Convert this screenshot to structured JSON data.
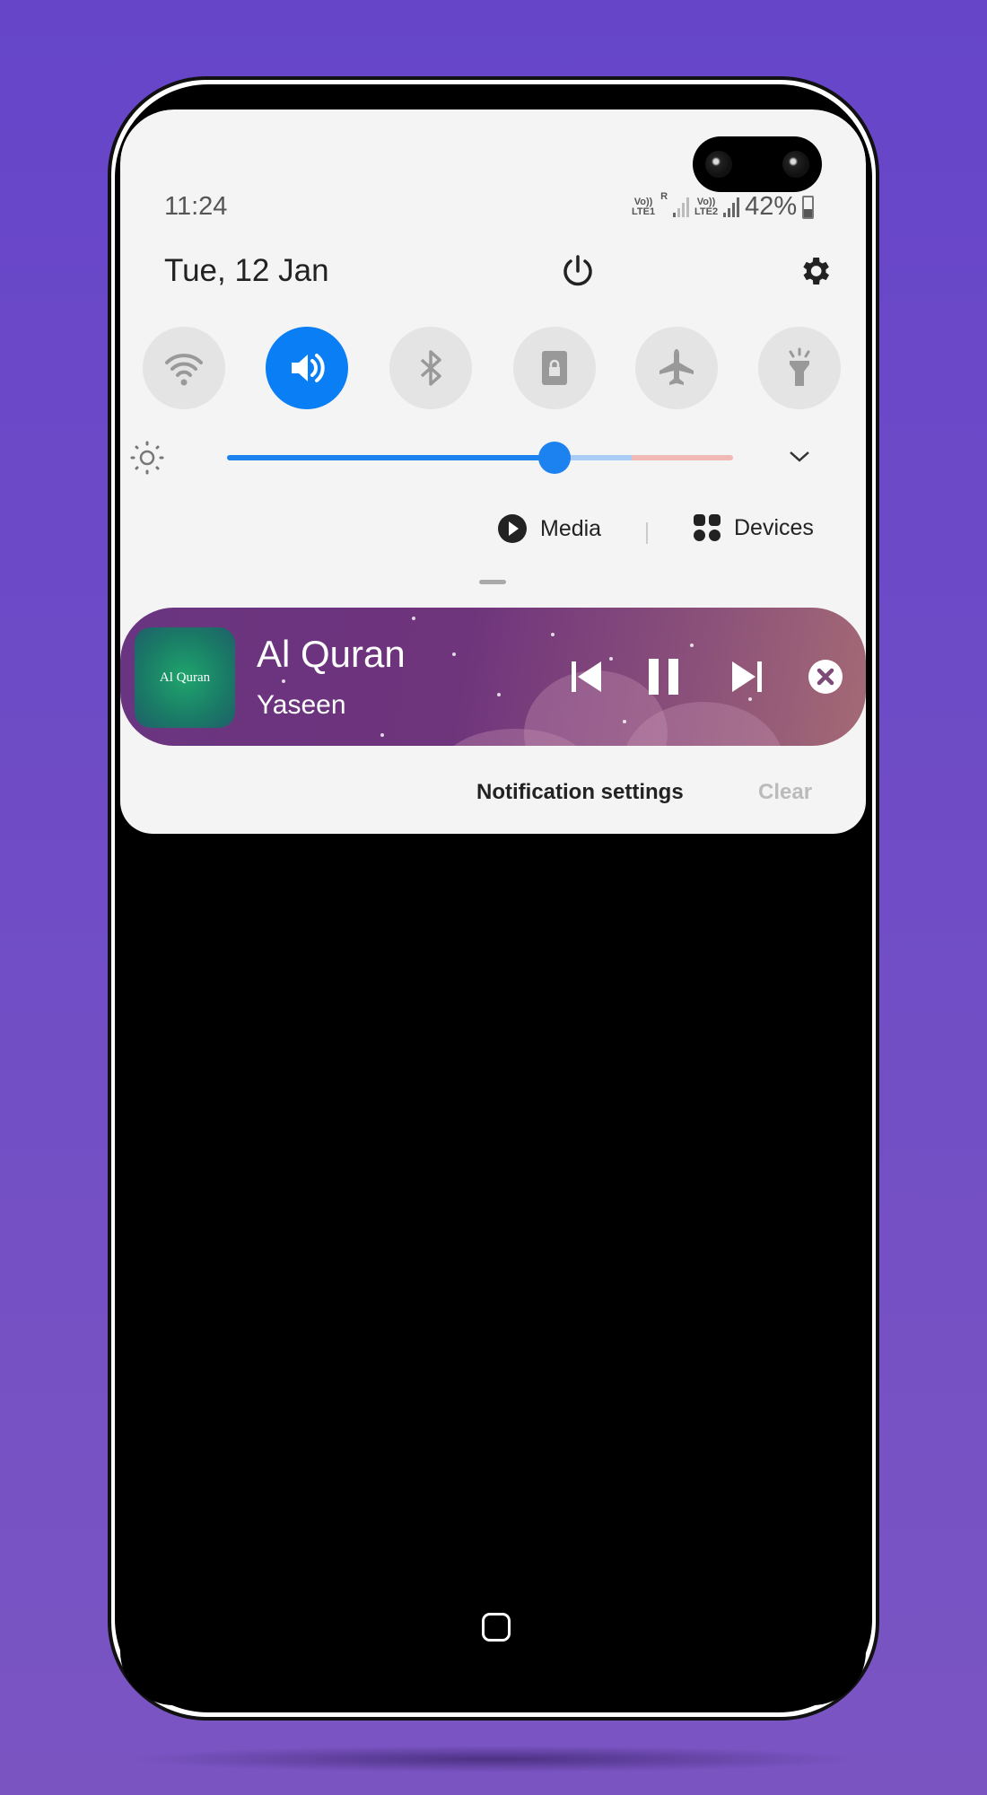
{
  "status_bar": {
    "time": "11:24",
    "sim1": {
      "top": "Vo))",
      "bottom": "LTE1",
      "roaming": "R"
    },
    "sim2": {
      "top": "Vo))",
      "bottom": "LTE2"
    },
    "battery": "42%"
  },
  "header": {
    "date": "Tue, 12 Jan",
    "icons": [
      "power-icon",
      "settings-icon"
    ]
  },
  "quick_toggles": [
    {
      "name": "wifi",
      "icon": "wifi-icon",
      "active": false
    },
    {
      "name": "sound",
      "icon": "volume-icon",
      "active": true
    },
    {
      "name": "bluetooth",
      "icon": "bluetooth-icon",
      "active": false
    },
    {
      "name": "portrait-lock",
      "icon": "rotation-lock-icon",
      "active": false
    },
    {
      "name": "airplane",
      "icon": "airplane-icon",
      "active": false
    },
    {
      "name": "flashlight",
      "icon": "flashlight-icon",
      "active": false
    }
  ],
  "brightness": {
    "level_percent": 64
  },
  "media_row": {
    "media_label": "Media",
    "devices_label": "Devices"
  },
  "notification": {
    "app_icon_text": "Al Quran",
    "title": "Al Quran",
    "subtitle": "Yaseen",
    "controls": [
      "previous",
      "pause",
      "next",
      "close"
    ]
  },
  "footer": {
    "settings_label": "Notification settings",
    "clear_label": "Clear"
  },
  "colors": {
    "accent": "#0a7ef5",
    "background": "#6645c9",
    "panel": "#f4f4f4"
  }
}
